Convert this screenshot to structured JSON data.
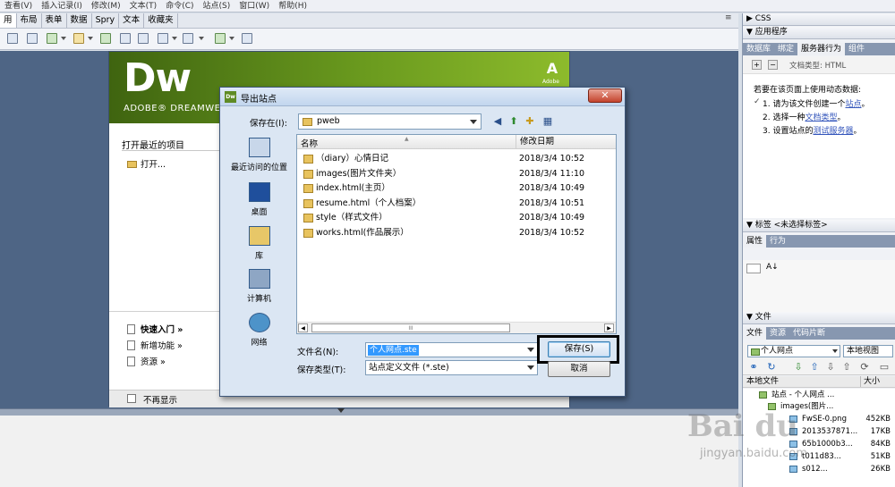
{
  "menubar": [
    "查看(V)",
    "插入记录(I)",
    "修改(M)",
    "文本(T)",
    "命令(C)",
    "站点(S)",
    "窗口(W)",
    "帮助(H)"
  ],
  "insert_tabs": [
    "用",
    "布局",
    "表单",
    "数据",
    "Spry",
    "文本",
    "收藏夹"
  ],
  "start_page": {
    "logo": "Dw",
    "banner_text": "ADOBE® DREAMWE",
    "adobe_mark": "Adobe",
    "recent_heading": "打开最近的项目",
    "open_item": "打开...",
    "quick_start": "快速入门 »",
    "new_features": "新增功能 »",
    "resources": "资源 »",
    "dont_show": "不再显示"
  },
  "right_panel": {
    "css_header": "▶ CSS",
    "app_header": "▼ 应用程序",
    "app_tabs": [
      "数据库",
      "绑定",
      "服务器行为",
      "组件"
    ],
    "doc_type_info": "文档类型: HTML",
    "intro": "若要在该页面上使用动态数据:",
    "check": "✓",
    "steps": [
      {
        "num": "1.",
        "text": "请为该文件创建一个",
        "link": "站点",
        "tail": "。"
      },
      {
        "num": "2.",
        "text": "选择一种",
        "link": "文档类型",
        "tail": "。"
      },
      {
        "num": "3.",
        "text": "设置站点的",
        "link": "测试服务器",
        "tail": "。"
      }
    ],
    "tags_header": "▼ 标签 <未选择标签>",
    "tags_tabs": [
      "属性",
      "行为"
    ],
    "files_header": "▼ 文件",
    "files_tabs": [
      "文件",
      "资源",
      "代码片断"
    ],
    "site_select": "个人网点",
    "view_select": "本地视图",
    "col_local": "本地文件",
    "col_size": "大小",
    "tree": [
      {
        "name": "站点 - 个人网点 ...",
        "size": "",
        "depth": 0,
        "kind": "folder"
      },
      {
        "name": "images(图片...",
        "size": "",
        "depth": 1,
        "kind": "folder"
      },
      {
        "name": "FwSE-0.png",
        "size": "452KB",
        "depth": 2,
        "kind": "image"
      },
      {
        "name": "2013537871...",
        "size": "17KB",
        "depth": 2,
        "kind": "image"
      },
      {
        "name": "65b1000b3...",
        "size": "84KB",
        "depth": 2,
        "kind": "image"
      },
      {
        "name": "t011d83...",
        "size": "51KB",
        "depth": 2,
        "kind": "image"
      },
      {
        "name": "s012...",
        "size": "26KB",
        "depth": 2,
        "kind": "image"
      }
    ]
  },
  "dialog": {
    "title": "导出站点",
    "save_in_label": "保存在(I):",
    "save_in_value": "pweb",
    "places": [
      "最近访问的位置",
      "桌面",
      "库",
      "计算机",
      "网络"
    ],
    "col_name": "名称",
    "col_date": "修改日期",
    "files": [
      {
        "name": "（diary）心情日记",
        "date": "2018/3/4 10:52"
      },
      {
        "name": "images(图片文件夹）",
        "date": "2018/3/4 11:10"
      },
      {
        "name": "index.html(主页）",
        "date": "2018/3/4 10:49"
      },
      {
        "name": "resume.html（个人档案）",
        "date": "2018/3/4 10:51"
      },
      {
        "name": "style（样式文件）",
        "date": "2018/3/4 10:49"
      },
      {
        "name": "works.html(作品展示）",
        "date": "2018/3/4 10:52"
      }
    ],
    "filename_label": "文件名(N):",
    "filename_value": "个人网点.ste",
    "filetype_label": "保存类型(T):",
    "filetype_value": "站点定义文件 (*.ste)",
    "save_button": "保存(S)",
    "cancel_button": "取消",
    "scroll_grip": "III"
  },
  "watermark": {
    "brand": "Bai du",
    "url": "jingyan.baidu.com"
  }
}
